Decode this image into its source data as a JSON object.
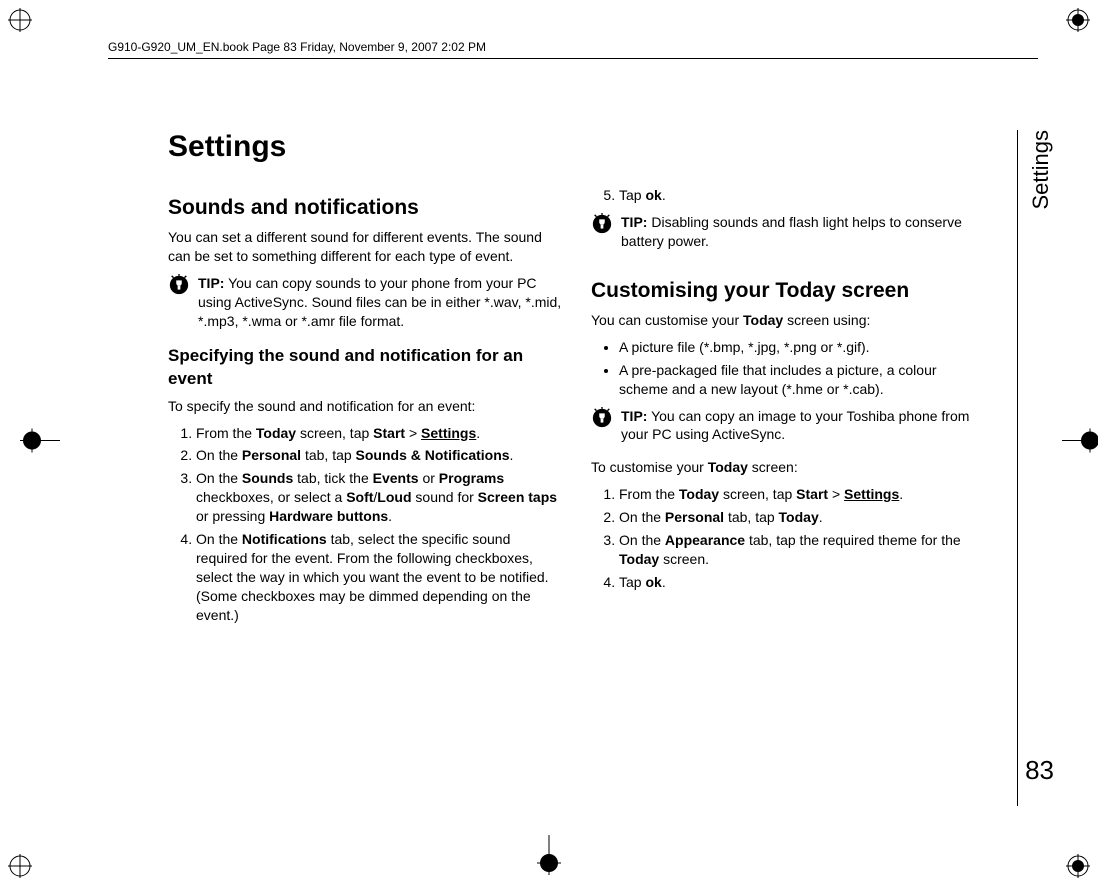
{
  "header": "G910-G920_UM_EN.book  Page 83  Friday, November 9, 2007  2:02 PM",
  "title": "Settings",
  "side_label": "Settings",
  "page_number": "83",
  "col1": {
    "h2": "Sounds and notifications",
    "p1": "You can set a different sound for different events. The sound can be set to something different for each type of event.",
    "tip1_label": "TIP:",
    "tip1": "You can copy sounds to your phone from your PC using ActiveSync. Sound files can be in either *.wav, *.mid, *.mp3, *.wma or *.amr file format.",
    "h3": "Specifying the sound and notification for an event",
    "p2": "To specify the sound and notification for an event:",
    "steps": {
      "s1_a": "From the ",
      "s1_b": "Today",
      "s1_c": " screen, tap ",
      "s1_d": "Start",
      "s1_e": " > ",
      "s1_f": "Settings",
      "s1_g": ".",
      "s2_a": "On the ",
      "s2_b": "Personal",
      "s2_c": " tab, tap ",
      "s2_d": "Sounds & Notifications",
      "s2_e": ".",
      "s3_a": "On the ",
      "s3_b": "Sounds",
      "s3_c": " tab, tick the ",
      "s3_d": "Events",
      "s3_e": " or ",
      "s3_f": "Programs",
      "s3_g": " checkboxes, or select a ",
      "s3_h": "Soft",
      "s3_i": "/",
      "s3_j": "Loud",
      "s3_k": " sound for ",
      "s3_l": "Screen taps",
      "s3_m": " or pressing ",
      "s3_n": "Hardware buttons",
      "s3_o": ".",
      "s4_a": "On the ",
      "s4_b": "Notifications",
      "s4_c": " tab, select the specific sound required for the event. From the following checkboxes, select the way in which you want the event to be notified. (Some checkboxes may be dimmed depending on the event.)"
    }
  },
  "col2": {
    "s5_a": "Tap ",
    "s5_b": "ok",
    "s5_c": ".",
    "tip2_label": "TIP:",
    "tip2": "Disabling sounds and flash light helps to conserve battery power.",
    "h2": "Customising your Today screen",
    "p1_a": "You can customise your ",
    "p1_b": "Today",
    "p1_c": " screen using:",
    "bullets": {
      "b1": "A picture file (*.bmp, *.jpg, *.png or *.gif).",
      "b2": "A pre-packaged file that includes a picture, a colour scheme and a new layout (*.hme or *.cab)."
    },
    "tip3_label": "TIP:",
    "tip3": "You can copy an image to your Toshiba phone from your PC using ActiveSync.",
    "p2_a": "To customise your ",
    "p2_b": "Today",
    "p2_c": " screen:",
    "steps2": {
      "s1_a": "From the ",
      "s1_b": "Today",
      "s1_c": " screen, tap ",
      "s1_d": "Start",
      "s1_e": " > ",
      "s1_f": "Settings",
      "s1_g": ".",
      "s2_a": "On the ",
      "s2_b": "Personal",
      "s2_c": " tab, tap ",
      "s2_d": "Today",
      "s2_e": ".",
      "s3_a": "On the ",
      "s3_b": "Appearance",
      "s3_c": " tab, tap the required theme for the ",
      "s3_d": "Today",
      "s3_e": " screen.",
      "s4_a": "Tap ",
      "s4_b": "ok",
      "s4_c": "."
    }
  }
}
